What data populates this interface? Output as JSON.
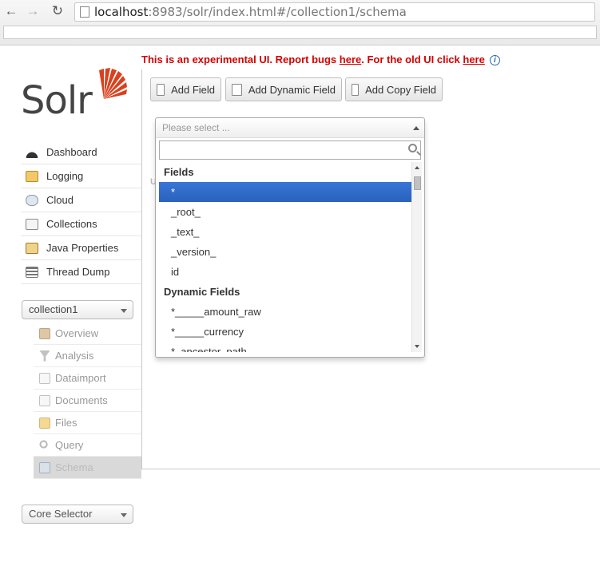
{
  "browser": {
    "url_host": "localhost",
    "url_rest": ":8983/solr/index.html#/collection1/schema"
  },
  "banner": {
    "text_before": "This is an experimental UI. Report bugs ",
    "link1": "here",
    "text_middle": ". For the old UI click ",
    "link2": "here"
  },
  "logo": {
    "text": "Solr"
  },
  "sidebar": {
    "items": [
      {
        "label": "Dashboard",
        "icon": "dashboard-icon"
      },
      {
        "label": "Logging",
        "icon": "logging-icon"
      },
      {
        "label": "Cloud",
        "icon": "cloud-icon"
      },
      {
        "label": "Collections",
        "icon": "collections-icon"
      },
      {
        "label": "Java Properties",
        "icon": "java-properties-icon"
      },
      {
        "label": "Thread Dump",
        "icon": "thread-dump-icon"
      }
    ],
    "collection_select": "collection1",
    "sub_items": [
      {
        "label": "Overview"
      },
      {
        "label": "Analysis"
      },
      {
        "label": "Dataimport"
      },
      {
        "label": "Documents"
      },
      {
        "label": "Files"
      },
      {
        "label": "Query"
      },
      {
        "label": "Schema"
      }
    ],
    "core_selector": "Core Selector"
  },
  "toolbar": {
    "add_field": "Add Field",
    "add_dynamic_field": "Add Dynamic Field",
    "add_copy_field": "Add Copy Field"
  },
  "dropdown": {
    "placeholder": "Please select ...",
    "search_value": "",
    "groups": [
      {
        "label": "Fields",
        "options": [
          "*",
          "_root_",
          "_text_",
          "_version_",
          "id"
        ]
      },
      {
        "label": "Dynamic Fields",
        "options": [
          "*_____amount_raw",
          "*_____currency",
          "*_ancestor_path"
        ]
      }
    ],
    "highlighted": "*"
  },
  "ghost_label": "U"
}
